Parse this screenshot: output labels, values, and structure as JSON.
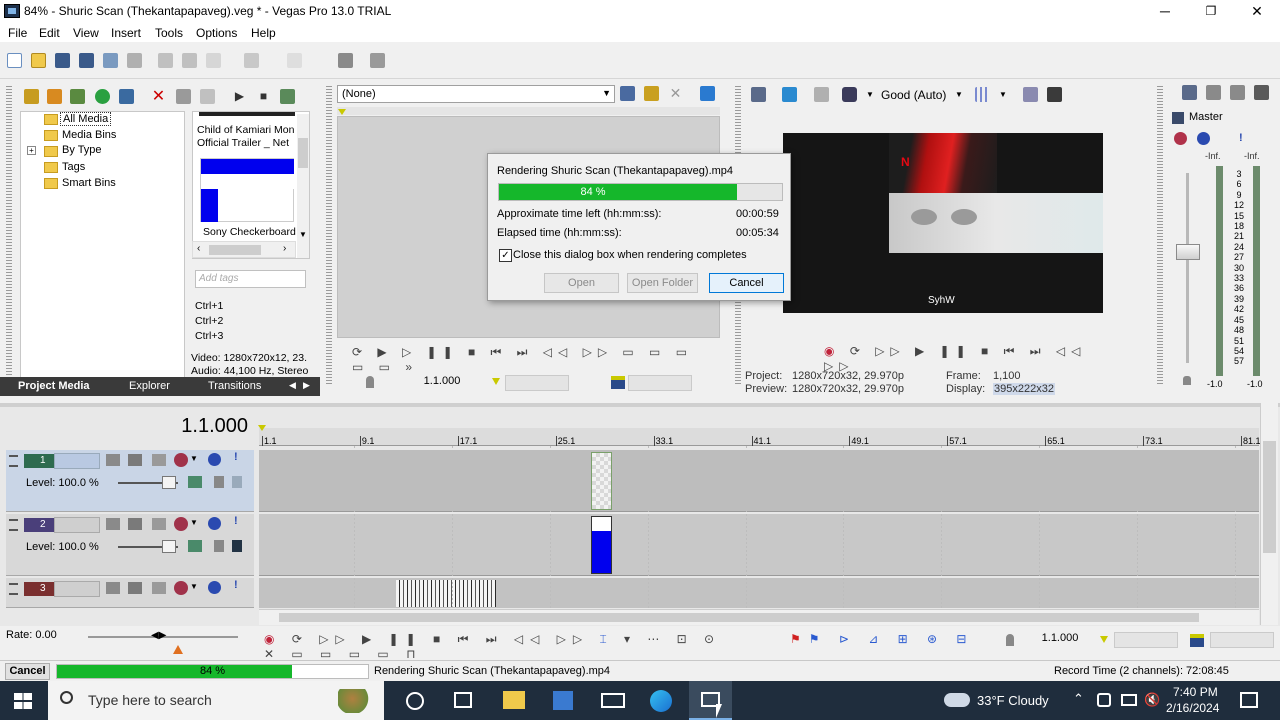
{
  "window": {
    "title": "84% - Shuric Scan (Thekantapapaveg).veg * - Vegas Pro 13.0 TRIAL",
    "minimize": "─",
    "maximize": "❐",
    "close": "✕"
  },
  "menu": [
    "File",
    "Edit",
    "View",
    "Insert",
    "Tools",
    "Options",
    "Help"
  ],
  "project_media": {
    "tree": [
      {
        "label": "All Media",
        "selected": true
      },
      {
        "label": "Media Bins"
      },
      {
        "label": "By Type",
        "expander": "+"
      },
      {
        "label": "Tags"
      },
      {
        "label": "Smart Bins"
      }
    ],
    "media_items": [
      {
        "title_line1": "Child of Kamiari Mon",
        "title_line2": "Official Trailer _ Net"
      },
      {
        "title_line1": "Sony Checkerboard"
      }
    ],
    "tags_placeholder": "Add tags",
    "shortcuts": [
      "Ctrl+1",
      "Ctrl+2",
      "Ctrl+3"
    ],
    "info_video": "Video: 1280x720x12, 23.",
    "info_audio": "Audio: 44,100 Hz, Stereo",
    "tabs": [
      "Project Media",
      "Explorer",
      "Transitions"
    ]
  },
  "trimmer": {
    "dropdown_value": "(None)",
    "position": "1.1.000"
  },
  "preview": {
    "quality": "Good (Auto)",
    "project_label": "Project:",
    "project_value": "1280x720x32, 29.970p",
    "preview_label": "Preview:",
    "preview_value": "1280x720x32, 29.970p",
    "frame_label": "Frame:",
    "frame_value": "1,100",
    "display_label": "Display:",
    "display_value": "395x222x32",
    "overlay_text": "SyhW",
    "logo_letter": "N"
  },
  "master": {
    "label": "Master",
    "inf_left": "-Inf.",
    "inf_right": "-Inf.",
    "scale": [
      "3",
      "6",
      "9",
      "12",
      "15",
      "18",
      "21",
      "24",
      "27",
      "30",
      "33",
      "36",
      "39",
      "42",
      "45",
      "48",
      "51",
      "54",
      "57"
    ],
    "bottom_left": "-1.0",
    "bottom_right": "-1.0"
  },
  "render_dialog": {
    "title": "Rendering Shuric Scan (Thekantapapaveg).mp4",
    "progress_percent": 84,
    "progress_label": "84 %",
    "time_left_label": "Approximate time left (hh:mm:ss):",
    "time_left_value": "00:00:59",
    "elapsed_label": "Elapsed time (hh:mm:ss):",
    "elapsed_value": "00:05:34",
    "checkbox_label": "Close this dialog box when rendering completes",
    "checkbox_checked": true,
    "open_label": "Open",
    "open_folder_label": "Open Folder",
    "cancel_label": "Cancel"
  },
  "timeline": {
    "time_display": "1.1.000",
    "ruler": [
      "1.1",
      "9.1",
      "17.1",
      "25.1",
      "33.1",
      "41.1",
      "49.1",
      "57.1",
      "65.1",
      "73.1",
      "81.1"
    ],
    "tracks": [
      {
        "number": "1",
        "level": "Level: 100.0 %",
        "color": "#2e6b4f"
      },
      {
        "number": "2",
        "level": "Level: 100.0 %",
        "color": "#4a3f7a"
      },
      {
        "number": "3",
        "color": "#7a2f2f"
      }
    ],
    "rate": "Rate: 0.00",
    "bottom_position": "1.1.000"
  },
  "statusbar": {
    "cancel_label": "Cancel",
    "progress_percent": 84,
    "progress_label": "84 %",
    "status_text": "Rendering Shuric Scan (Thekantapapaveg).mp4",
    "record_time": "Record Time (2 channels): 72:08:45"
  },
  "taskbar": {
    "search_placeholder": "Type here to search",
    "weather": "33°F  Cloudy",
    "time": "7:40 PM",
    "date": "2/16/2024"
  },
  "colors": {
    "progress_green": "#15b72b",
    "clip_blue": "#0000ee",
    "accent_blue": "#0078d7",
    "taskbar_bg": "#1f2d3d"
  }
}
